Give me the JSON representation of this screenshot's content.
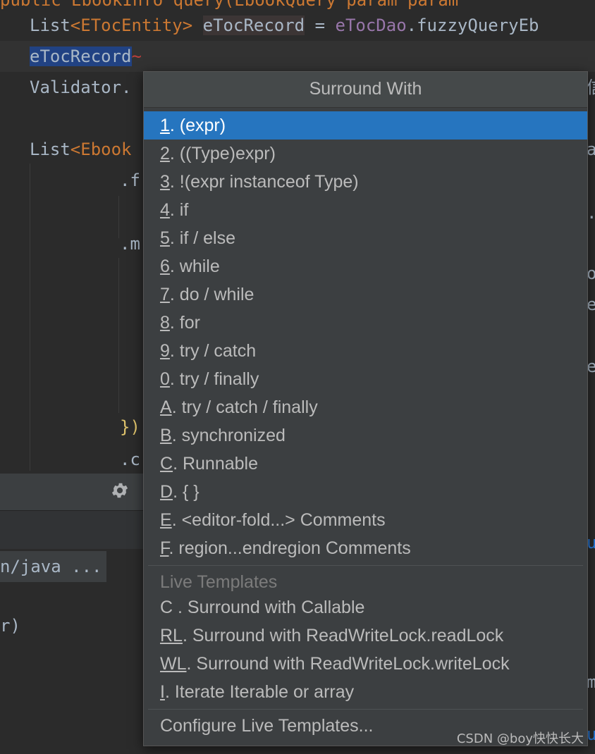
{
  "editor": {
    "line0": "public EbookInfo query(EbookQuery param param",
    "line1_type": "List",
    "line1_generic": "<ETocEntity>",
    "line1_var": "eTocRecord",
    "line1_eq": " = ",
    "line1_dao": "eTocDao",
    "line1_call": ".fuzzyQueryEb",
    "line2_selected": "eTocRecord",
    "line3": "Validator.",
    "line3_tail": "信",
    "line5_type": "List",
    "line5_generic": "<Ebook",
    "line5_tail": "a",
    "line6": ".f",
    "line7_tail": ".",
    "line8": ".m",
    "line8_tail": "o",
    "line9_tail": "e",
    "line11_tail": "e",
    "line14": "})",
    "line15": ".c"
  },
  "bottom_panel": {
    "gear_icon": "gear-icon",
    "path_text": "n/java ...",
    "paren_text": "r)",
    "right_tails": [
      "u",
      "m",
      "u"
    ]
  },
  "popup": {
    "title": "Surround With",
    "items": [
      {
        "key": "1",
        "rest": ". (expr)"
      },
      {
        "key": "2",
        "rest": ". ((Type)expr)"
      },
      {
        "key": "3",
        "rest": ". !(expr instanceof Type)"
      },
      {
        "key": "4",
        "rest": ". if"
      },
      {
        "key": "5",
        "rest": ". if / else"
      },
      {
        "key": "6",
        "rest": ". while"
      },
      {
        "key": "7",
        "rest": ". do / while"
      },
      {
        "key": "8",
        "rest": ". for"
      },
      {
        "key": "9",
        "rest": ". try / catch"
      },
      {
        "key": "0",
        "rest": ". try / finally"
      },
      {
        "key": "A",
        "rest": ". try / catch / finally"
      },
      {
        "key": "B",
        "rest": ". synchronized"
      },
      {
        "key": "C",
        "rest": ". Runnable"
      },
      {
        "key": "D",
        "rest": ". { }"
      },
      {
        "key": "E",
        "rest": ". <editor-fold...> Comments"
      },
      {
        "key": "F",
        "rest": ". region...endregion Comments"
      }
    ],
    "live_templates_header": "Live Templates",
    "live_items": [
      {
        "key": "",
        "rest": "C . Surround with Callable"
      },
      {
        "key": "RL",
        "rest": ". Surround with ReadWriteLock.readLock"
      },
      {
        "key": "WL",
        "rest": ". Surround with ReadWriteLock.writeLock"
      },
      {
        "key": "I",
        "rest": ". Iterate Iterable or array"
      }
    ],
    "configure": "Configure Live Templates..."
  },
  "watermark": "CSDN @boy快快长大",
  "colors": {
    "selection": "#2675bf",
    "popup_bg": "#3c3f41",
    "editor_bg": "#2b2b2b",
    "keyword": "#cc7832",
    "method": "#9876aa"
  }
}
